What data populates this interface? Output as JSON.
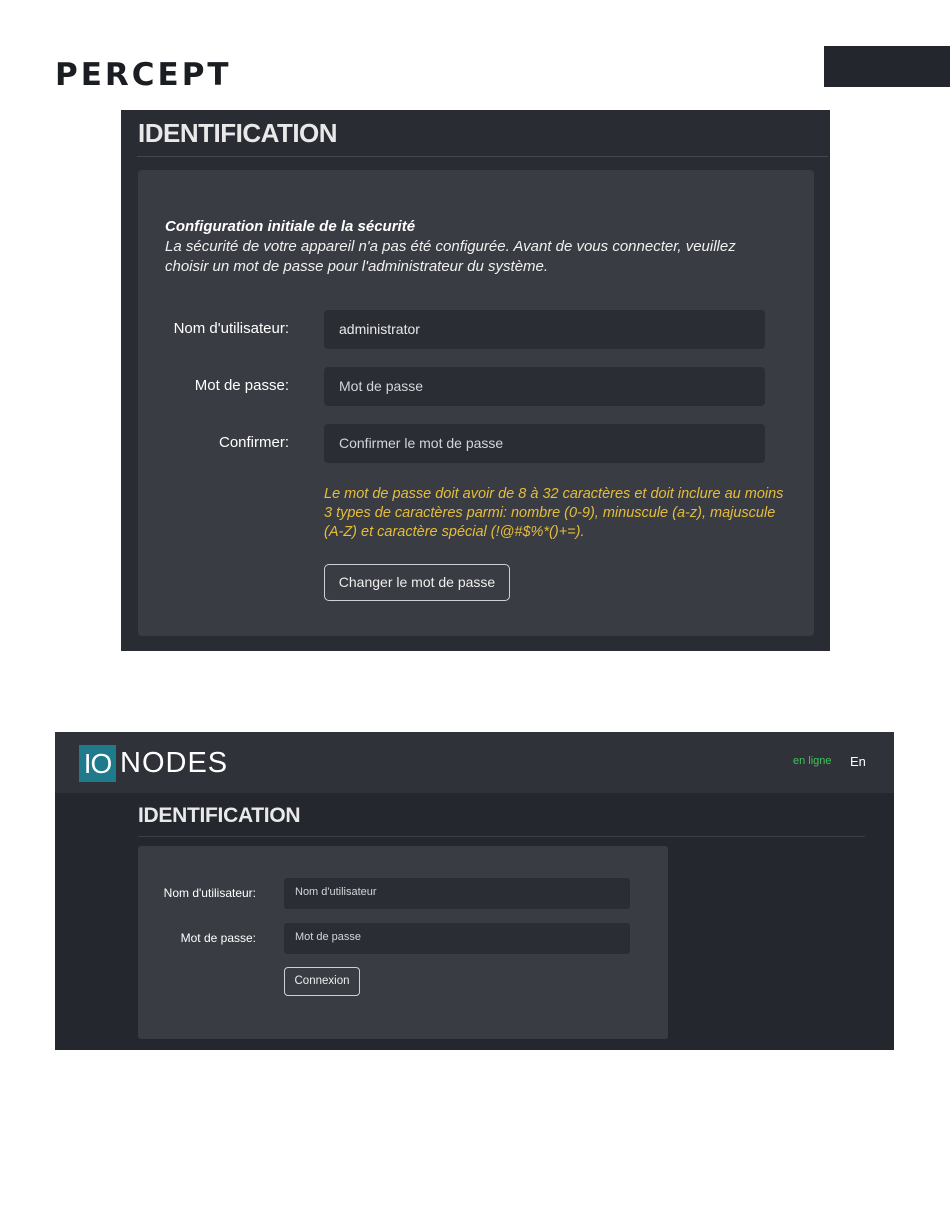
{
  "header": {
    "brand": "PERCEPT"
  },
  "setup_screen": {
    "title": "IDENTIFICATION",
    "heading": "Configuration initiale de la sécurité",
    "description": "La sécurité de votre appareil n'a pas été configurée. Avant de vous connecter, veuillez choisir un mot de passe pour l'administrateur du système.",
    "username_label": "Nom d'utilisateur:",
    "username_value": "administrator",
    "password_label": "Mot de passe:",
    "password_placeholder": "Mot de passe",
    "confirm_label": "Confirmer:",
    "confirm_placeholder": "Confirmer le mot de passe",
    "password_rules": "Le mot de passe doit avoir de 8 à 32 caractères et doit inclure au moins 3 types de caractères parmi: nombre (0-9), minuscule (a-z), majuscule (A-Z) et caractère spécial (!@#$%*()+=).",
    "change_button": "Changer le mot de passe",
    "colors": {
      "hint": "#e5bd3b",
      "panel": "#3a3c43"
    }
  },
  "login_screen": {
    "logo_io": "IO",
    "logo_nodes": "NODES",
    "status": "en ligne",
    "language": "En",
    "title": "IDENTIFICATION",
    "username_label": "Nom d'utilisateur:",
    "username_placeholder": "Nom d'utilisateur",
    "password_label": "Mot de passe:",
    "password_placeholder": "Mot de passe",
    "login_button": "Connexion",
    "colors": {
      "accent": "#1f7a8c",
      "online": "#3fc35a"
    }
  }
}
